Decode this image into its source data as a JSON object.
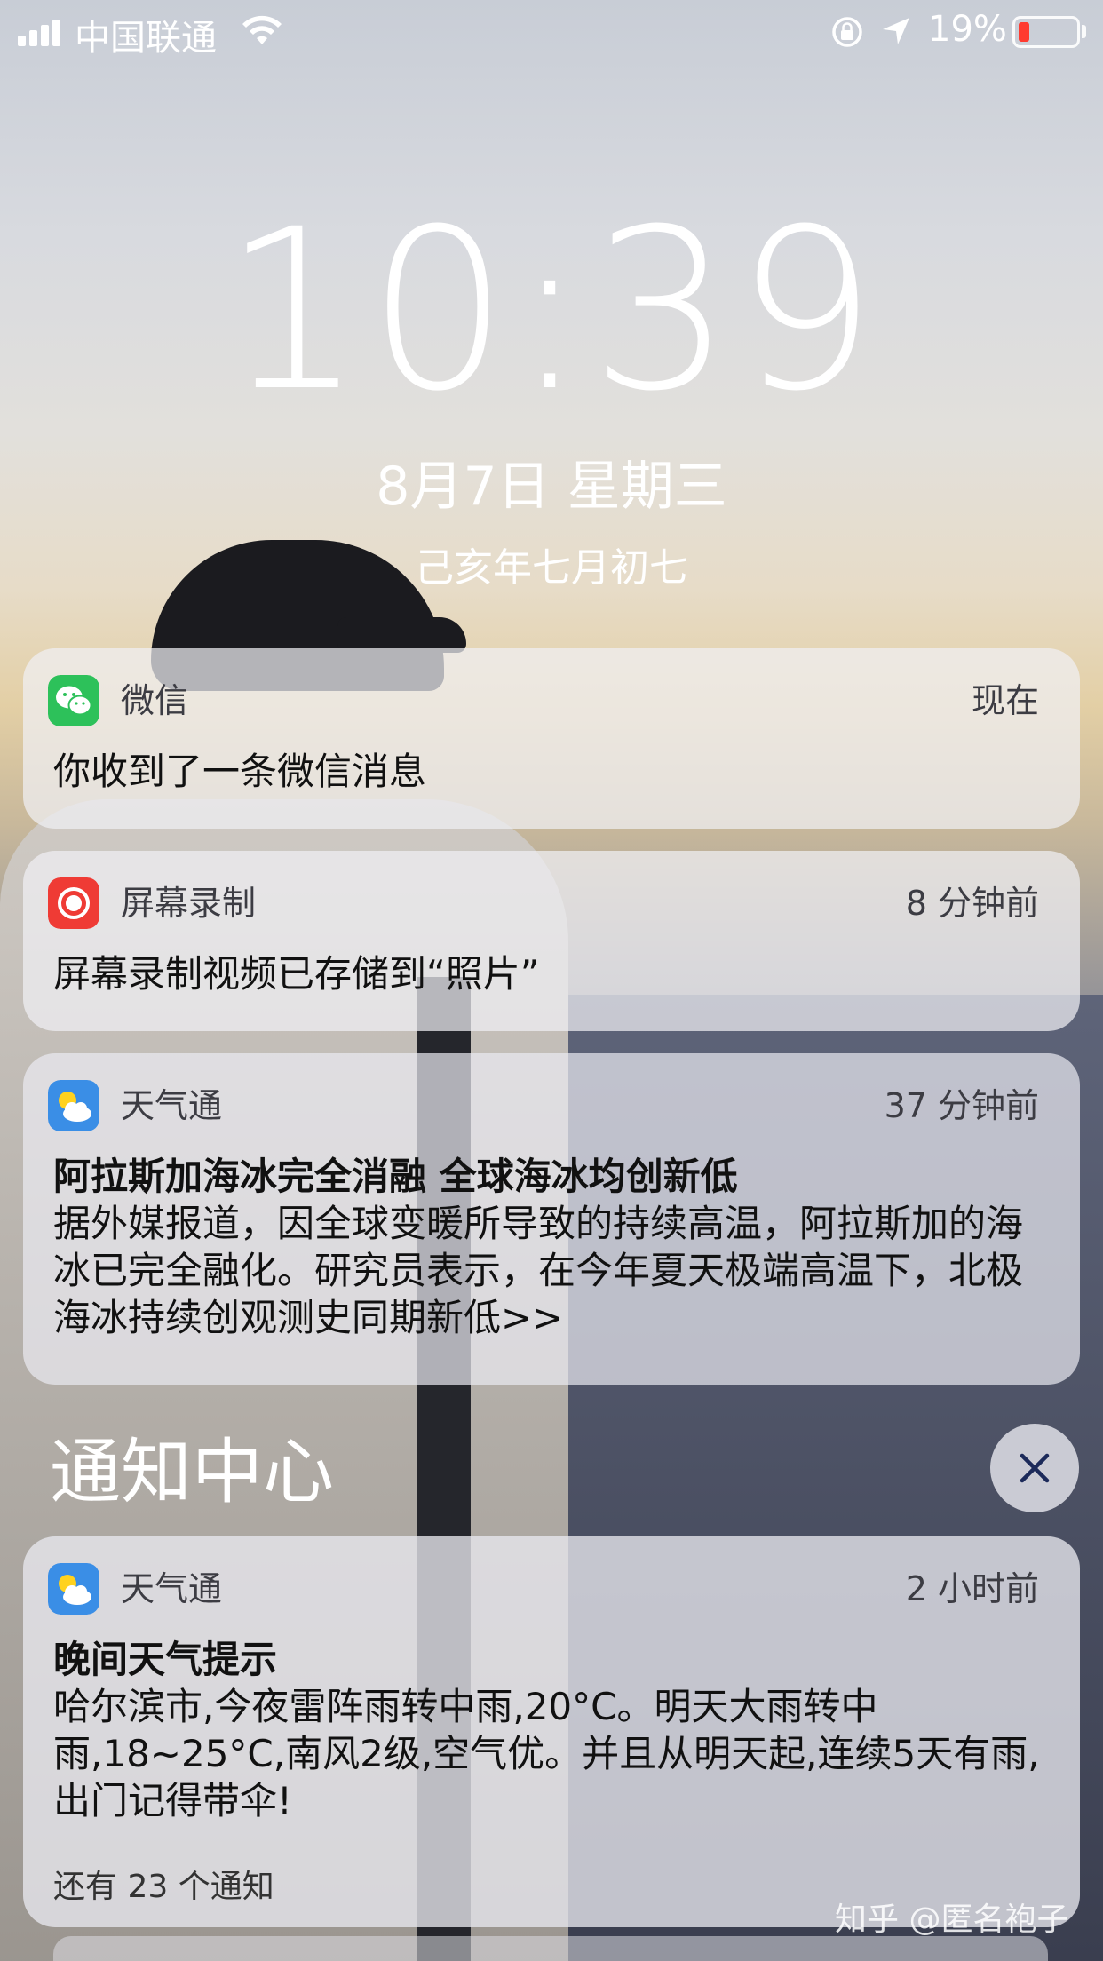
{
  "status_bar": {
    "carrier": "中国联通",
    "battery_percent": "19%",
    "battery_level": 0.19,
    "icons": [
      "signal-icon",
      "wifi-icon",
      "rotation-lock-icon",
      "location-icon",
      "battery-icon"
    ]
  },
  "lock_screen": {
    "time": "10:39",
    "date": "8月7日 星期三",
    "lunar_date": "己亥年七月初七"
  },
  "notifications": [
    {
      "app": "微信",
      "time": "现在",
      "title": "",
      "body": "你收到了一条微信消息",
      "icon": "wechat-icon",
      "color": "#2dc15a"
    },
    {
      "app": "屏幕录制",
      "time": "8 分钟前",
      "title": "",
      "body": "屏幕录制视频已存储到“照片”",
      "icon": "screen-record-icon",
      "color": "#ef3b35"
    },
    {
      "app": "天气通",
      "time": "37 分钟前",
      "title": "阿拉斯加海冰完全消融 全球海冰均创新低",
      "body": "据外媒报道，因全球变暖所导致的持续高温，阿拉斯加的海冰已完全融化。研究员表示，在今年夏天极端高温下，北极海冰持续创观测史同期新低>>",
      "icon": "weather-icon",
      "color": "#3a8ee6"
    }
  ],
  "notification_center": {
    "title": "通知中心",
    "close_icon": "close-icon",
    "item": {
      "app": "天气通",
      "time": "2 小时前",
      "title": "晚间天气提示",
      "body": "哈尔滨市,今夜雷阵雨转中雨,20°C。明天大雨转中雨,18~25°C,南风2级,空气优。并且从明天起,连续5天有雨,出门记得带伞!",
      "more": "还有 23 个通知",
      "icon": "weather-icon"
    }
  },
  "watermark": "知乎 @匿名袍子"
}
